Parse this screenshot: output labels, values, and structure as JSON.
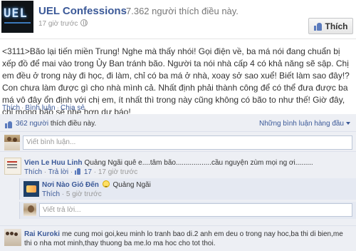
{
  "page": {
    "logo_text": "UEL",
    "name": "UEL Confessions",
    "likes": "7.362 người thích điều này.",
    "post_time": "17 giờ trước",
    "like_button": "Thích"
  },
  "post": {
    "body": "<3111>Bão lại tiến miền Trung! Nghe mà thấy nhói! Gọi điện về, ba má nói đang chuẩn bị xếp đồ để mai vào trong Ủy Ban tránh bão. Người ta nói nhà cấp 4 có khả năng sẽ sập. Chị em đều ở trong này đi học, đi làm, chỉ có ba má ở nhà, xoay sở sao xuể! Biết làm sao đây!? Con chưa làm được gì cho nhà mình cả. Nhất định phải thành công để có thể đưa được ba má vô đây ổn định với chị em, ít nhất thì trong này cũng không có bão to như thế! Giờ đây, chỉ mong bão sẽ nhẹ hơn dự báo!"
  },
  "actions": {
    "like": "Thích",
    "comment": "Bình luận",
    "share": "Chia sẻ"
  },
  "feedback": {
    "likes_count": "362 người",
    "likes_suffix": "thích điều này.",
    "sort_label": "Những bình luận hàng đầu",
    "comment_placeholder": "Viết bình luận..."
  },
  "comments": [
    {
      "author": "Vien Le Huu Linh",
      "text": "Quảng Ngãi quê e....tâm bão..................cầu nguyện zùm mọi ng ơi.........",
      "like_link": "Thích",
      "reply_link": "Trả lời",
      "like_count": "17",
      "time": "17 giờ trước",
      "reply": {
        "author": "Nơi Nào Gió Đến",
        "text": "Quảng Ngãi",
        "like_link": "Thích",
        "time": "5 giờ trước"
      },
      "reply_placeholder": "Viết trả lời..."
    },
    {
      "author": "Rai Kuroki",
      "text": "me cung moi goi,keu minh lo tranh bao di.2 anh em deu o trong nay hoc,ba thi di bien,me thi o nha mot minh,thay thuong ba me.lo ma hoc cho tot thoi."
    }
  ]
}
